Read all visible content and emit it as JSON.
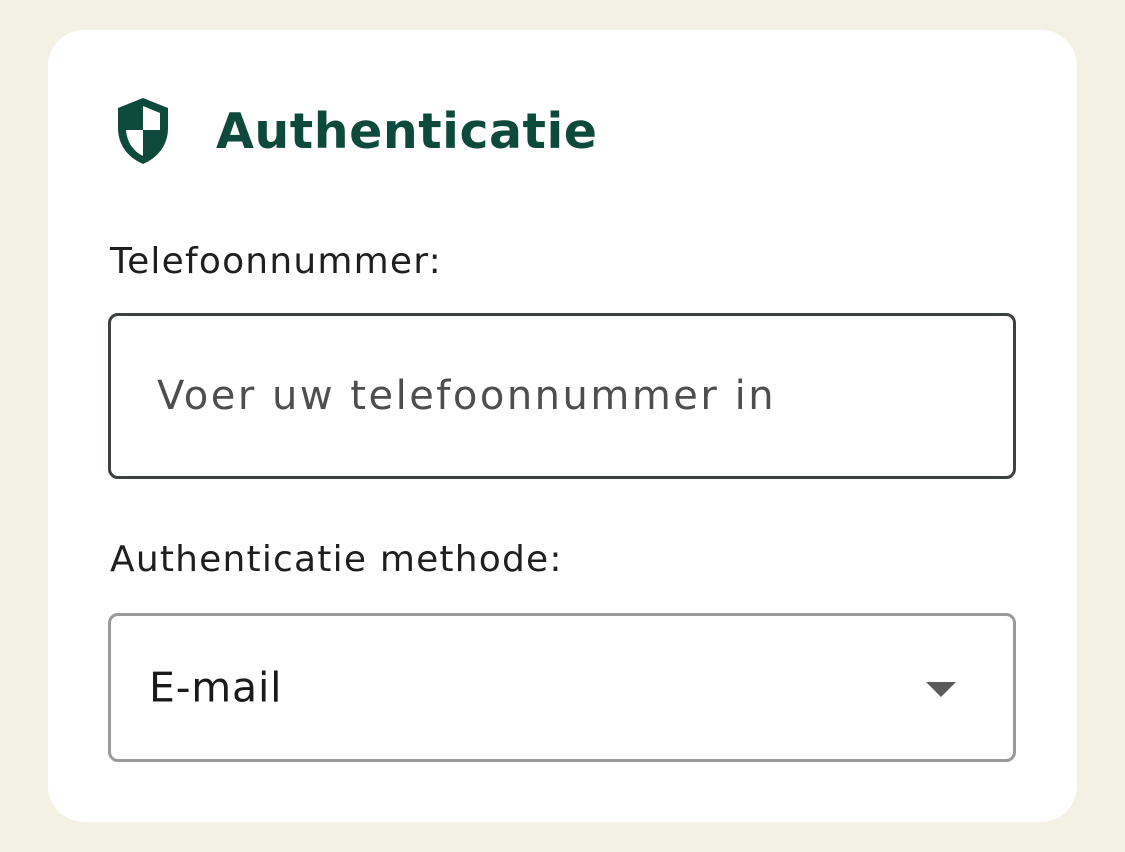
{
  "card": {
    "title": "Authenticatie",
    "icon": "shield-icon",
    "accent_color": "#0e4a3c"
  },
  "phone": {
    "label": "Telefoonnummer:",
    "placeholder": "Voer uw telefoonnummer in",
    "value": ""
  },
  "method": {
    "label": "Authenticatie methode:",
    "selected": "E-mail",
    "icon": "chevron-down-icon"
  }
}
